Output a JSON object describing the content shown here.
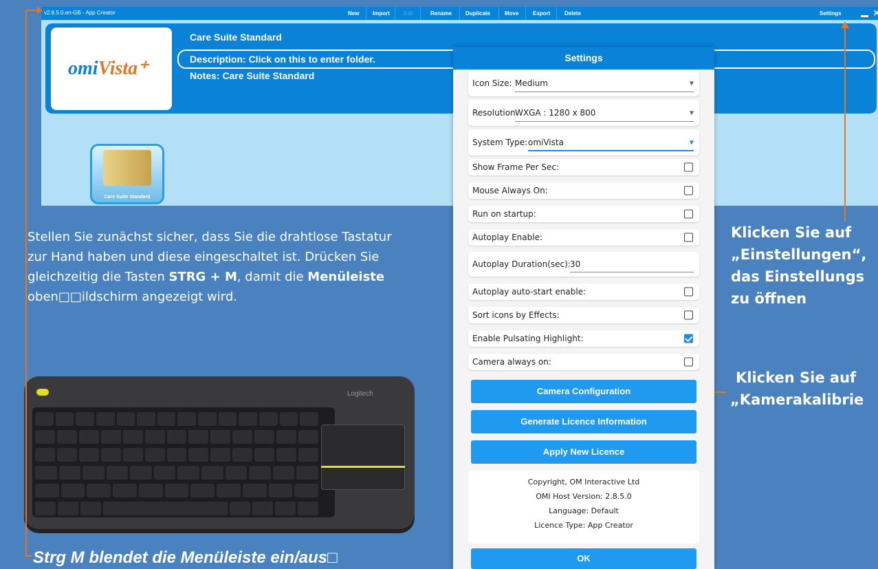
{
  "menubar": {
    "version": "v2.8.5.0.en-GB - App Creator",
    "buttons": [
      "New",
      "Import",
      "Edit",
      "Rename",
      "Duplicate",
      "Move",
      "Export",
      "Delete"
    ],
    "settings": "Settings"
  },
  "folder": {
    "logo_text_a": "omi",
    "logo_text_b": "Vista⁺",
    "title": "Care Suite Standard",
    "description": "Description: Click on this to enter folder.",
    "notes": "Notes: Care Suite Standard",
    "tile_caption": "Care Suite Standard"
  },
  "instructions": {
    "part1": "Stellen Sie zunächst sicher, dass Sie die drahtlose Tastatur zur Hand haben und diese eingeschaltet ist. Drücken Sie gleichzeitig die Tasten ",
    "keys": "STRG + M",
    "part2": ", damit die ",
    "menubar": "Menüleiste",
    "part3": " oben□□ildschirm angezeigt wird."
  },
  "keyboard": {
    "brand": "Logitech",
    "caption": "Strg M blendet die Menüleiste ein/aus□"
  },
  "settings": {
    "title": "Settings",
    "icon_size_label": "Icon Size:",
    "icon_size_value": "Medium",
    "resolution_label": "Resolution",
    "resolution_value": "WXGA : 1280 x 800",
    "system_type_label": "System Type:",
    "system_type_value": "omiVista",
    "show_fps": "Show Frame Per Sec:",
    "mouse_on": "Mouse Always On:",
    "run_startup": "Run on startup:",
    "autoplay_enable": "Autoplay Enable:",
    "autoplay_duration_label": "Autoplay Duration(sec):",
    "autoplay_duration_value": "30",
    "autoplay_autostart": "Autoplay auto-start enable:",
    "sort_icons": "Sort icons by Effects:",
    "pulsating": "Enable Pulsating Highlight:",
    "camera_on": "Camera always on:",
    "camera_config": "Camera Configuration",
    "gen_licence": "Generate Licence Information",
    "apply_licence": "Apply New Licence",
    "copyright": "Copyright, OM Interactive Ltd",
    "host_version": "OMI Host Version: 2.8.5.0",
    "language": "Language: Default",
    "licence_type": "Licence Type: App Creator",
    "ok": "OK"
  },
  "annotations": {
    "settings_l1": "Klicken Sie auf",
    "settings_l2": "„Einstellungen“,",
    "settings_l3": "das Einstellungs",
    "settings_l4": "zu öffnen",
    "camera_l1": "Klicken Sie auf",
    "camera_l2": "„Kamerakalibrie"
  },
  "colors": {
    "accent": "#0a82d8",
    "background": "#4a82c0",
    "arrow": "#e6761f",
    "keyboard_accent": "#e6dc1e"
  }
}
